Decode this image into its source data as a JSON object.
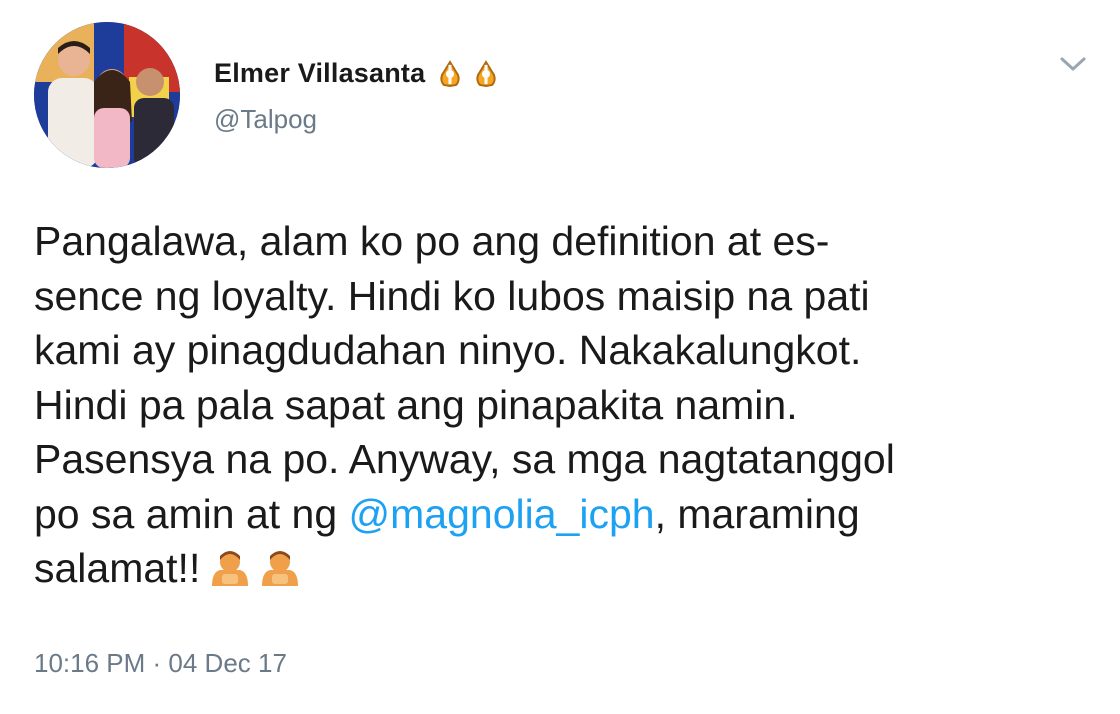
{
  "author": {
    "display_name": "Elmer  Villasanta",
    "handle": "@Talpog",
    "name_emojis": [
      "folded-hands-emoji",
      "folded-hands-emoji"
    ]
  },
  "tweet": {
    "lines": [
      "Pangalawa, alam ko po ang definition at es-",
      "sence ng loyalty. Hindi ko lubos maisip na pati",
      "kami ay pinagdudahan ninyo. Nakakalungkot.",
      "Hindi pa pala sapat ang pinapakita namin.",
      "Pasensya na po. Anyway, sa mga nagtatanggol"
    ],
    "line6_before": "po sa amin at ng ",
    "mention": "@magnolia_icph",
    "line6_after": ", maraming",
    "line7": "salamat!!",
    "trailing_emojis": [
      "person-bowing-emoji",
      "person-bowing-emoji"
    ],
    "timestamp": "10:16 PM · 04 Dec 17"
  },
  "colors": {
    "mention": "#1da1f2",
    "secondary_text": "#6b7a88",
    "primary_text": "#1a1a1a"
  },
  "icons": {
    "menu": "chevron-down-icon"
  }
}
